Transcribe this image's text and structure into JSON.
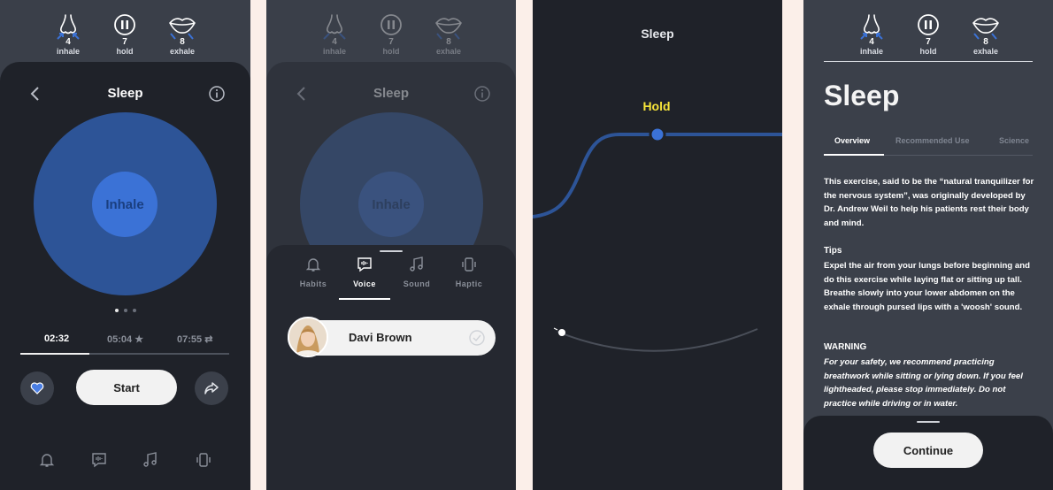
{
  "colors": {
    "accent": "#3b72d6",
    "circle_outer": "#2d5497",
    "hold_text": "#f6e43a",
    "card_bg": "#1f2229"
  },
  "stats": [
    {
      "icon": "nose-icon",
      "value": "4",
      "label": "inhale"
    },
    {
      "icon": "pause-icon",
      "value": "7",
      "label": "hold"
    },
    {
      "icon": "lips-icon",
      "value": "8",
      "label": "exhale"
    }
  ],
  "screen1": {
    "title": "Sleep",
    "circle_label": "Inhale",
    "pager": {
      "count": 3,
      "active": 1
    },
    "times": [
      {
        "label": "02:32",
        "active": true
      },
      {
        "label": "05:04 ★",
        "active": false
      },
      {
        "label": "07:55 ⇄",
        "active": false
      }
    ],
    "progress": 0.33,
    "start_label": "Start"
  },
  "screen2": {
    "title": "Sleep",
    "circle_label": "Inhale",
    "tabs": [
      {
        "label": "Habits",
        "icon": "bell-icon"
      },
      {
        "label": "Voice",
        "icon": "voice-icon",
        "active": true
      },
      {
        "label": "Sound",
        "icon": "music-note-icon"
      },
      {
        "label": "Haptic",
        "icon": "vibrate-icon"
      }
    ],
    "voice_name": "Davi Brown"
  },
  "screen3": {
    "title": "Sleep",
    "phase_label": "Hold"
  },
  "screen4": {
    "title": "Sleep",
    "tabs": [
      "Overview",
      "Recommended Use",
      "Science"
    ],
    "intro": "This exercise, said to be the “natural tranquilizer for the nervous system”, was originally developed by Dr. Andrew Weil to help his patients rest their body and mind.",
    "tips_heading": "Tips",
    "tips": "Expel the air from your lungs before beginning and do this exercise while laying flat or sitting up tall. Breathe slowly into your lower abdomen on the exhale through pursed lips with a 'woosh' sound.",
    "warning_heading": "WARNING",
    "warning": "For your safety, we recommend practicing breathwork while sitting or lying down. If you feel lightheaded, please stop immediately. Do not practice while driving or in water.",
    "continue_label": "Continue"
  }
}
